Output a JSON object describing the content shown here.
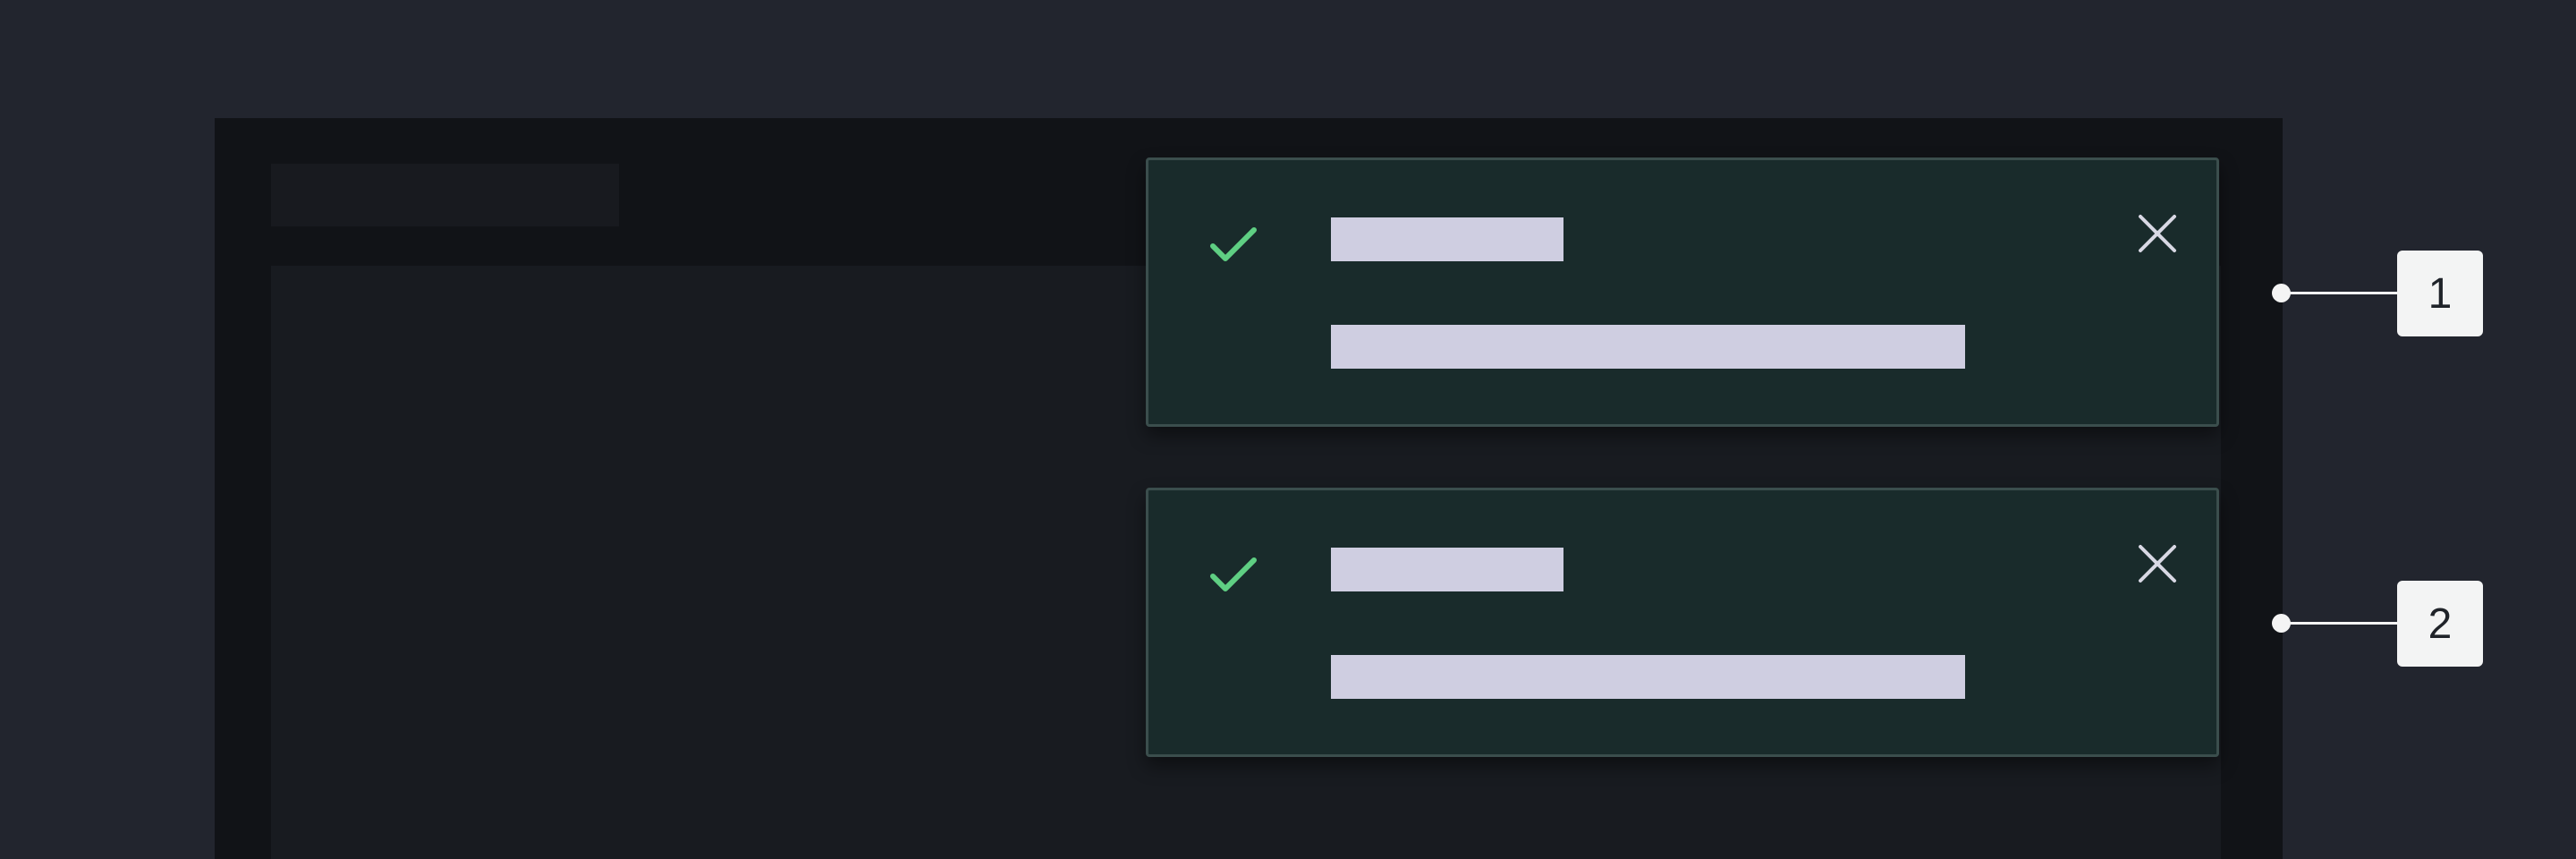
{
  "colors": {
    "page_background": "#22252e",
    "app_frame": "#111317",
    "toast_background": "#192b2b",
    "toast_border": "#3b4e4d",
    "success_check": "#5fcf83",
    "text_placeholder": "#cfcee1",
    "close_icon": "#d8d8e4",
    "callout": "#f4f4f4"
  },
  "toasts": [
    {
      "status": "success",
      "icon": "checkmark-icon",
      "close_icon": "close-icon"
    },
    {
      "status": "success",
      "icon": "checkmark-icon",
      "close_icon": "close-icon"
    }
  ],
  "callouts": [
    {
      "label": "1"
    },
    {
      "label": "2"
    }
  ]
}
